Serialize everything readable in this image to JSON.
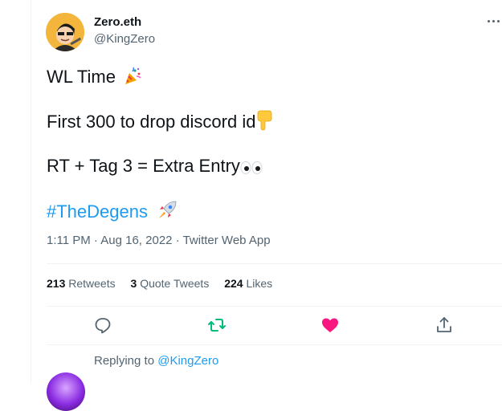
{
  "tweet": {
    "author_name": "Zero.eth",
    "author_handle": "@KingZero",
    "lines": [
      "WL Time",
      "First 300 to drop discord id",
      "RT + Tag 3 = Extra Entry"
    ],
    "hashtag": "#TheDegens",
    "emoji": {
      "party": "party-popper-icon",
      "point_down": "backhand-index-pointing-down-icon",
      "eyes": "eyes-icon",
      "rocket": "rocket-icon"
    },
    "time": "1:11 PM",
    "date": "Aug 16, 2022",
    "source": "Twitter Web App"
  },
  "stats": {
    "retweets_count": "213",
    "retweets_label": "Retweets",
    "quotes_count": "3",
    "quotes_label": "Quote Tweets",
    "likes_count": "224",
    "likes_label": "Likes"
  },
  "reply": {
    "replying_to_label": "Replying to",
    "replying_to_handle": "@KingZero"
  },
  "colors": {
    "accent": "#1d9bf0",
    "retweet": "#00ba7c",
    "like": "#f91880",
    "secondary_text": "#536471"
  }
}
